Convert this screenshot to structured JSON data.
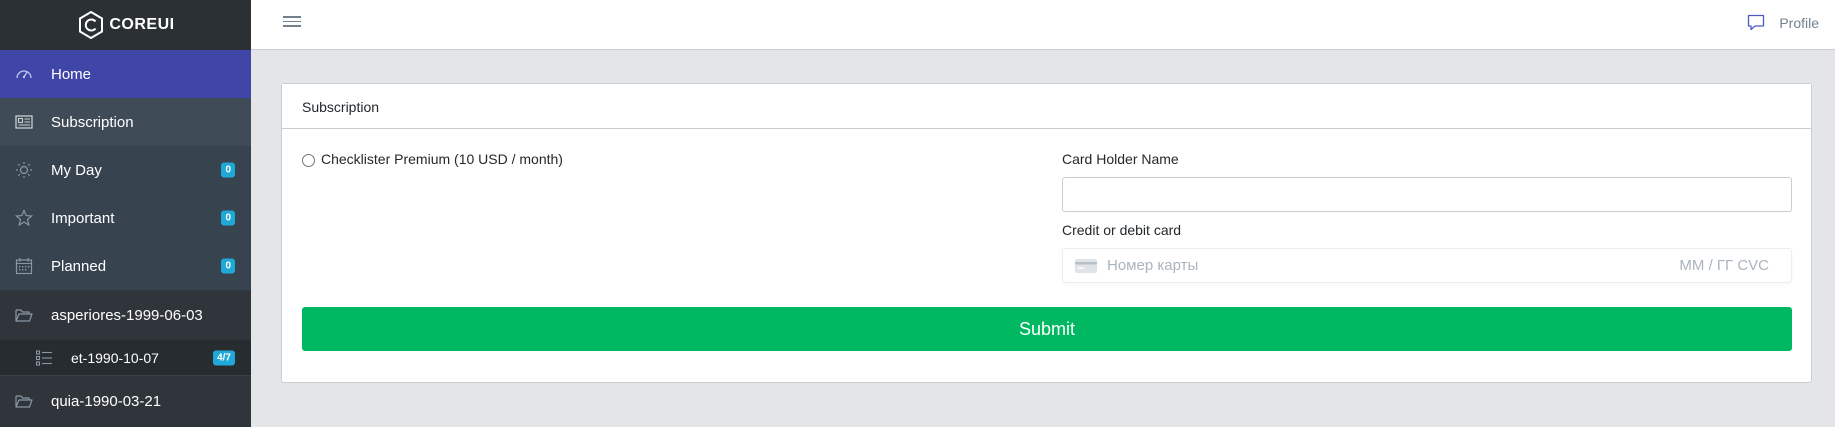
{
  "brand": {
    "name": "COREUI"
  },
  "sidebar": {
    "items": [
      {
        "label": "Home",
        "icon": "speedometer-icon"
      },
      {
        "label": "Subscription",
        "icon": "newspaper-icon"
      },
      {
        "label": "My Day",
        "icon": "sun-icon",
        "badge": "0"
      },
      {
        "label": "Important",
        "icon": "star-icon",
        "badge": "0"
      },
      {
        "label": "Planned",
        "icon": "calendar-icon",
        "badge": "0"
      }
    ],
    "folders": [
      {
        "label": "asperiores-1999-06-03",
        "icon": "folder-open-icon",
        "lists": [
          {
            "label": "et-1990-10-07",
            "icon": "list-icon",
            "badge": "4/7"
          }
        ]
      },
      {
        "label": "quia-1990-03-21",
        "icon": "folder-open-icon"
      }
    ]
  },
  "header": {
    "profile_label": "Profile"
  },
  "main": {
    "card_title": "Subscription",
    "plan_label": "Checklister Premium (10 USD / month)",
    "card_holder_label": "Card Holder Name",
    "card_holder_value": "",
    "card_label": "Credit or debit card",
    "card_number_placeholder": "Номер карты",
    "card_expiry_cvc_placeholder": "ММ / ГГ  CVC",
    "submit_label": "Submit"
  },
  "colors": {
    "sidebar_bg": "#2f353a",
    "active_bg": "#3f46a8",
    "badge": "#20a8d8",
    "submit": "#00b862"
  }
}
